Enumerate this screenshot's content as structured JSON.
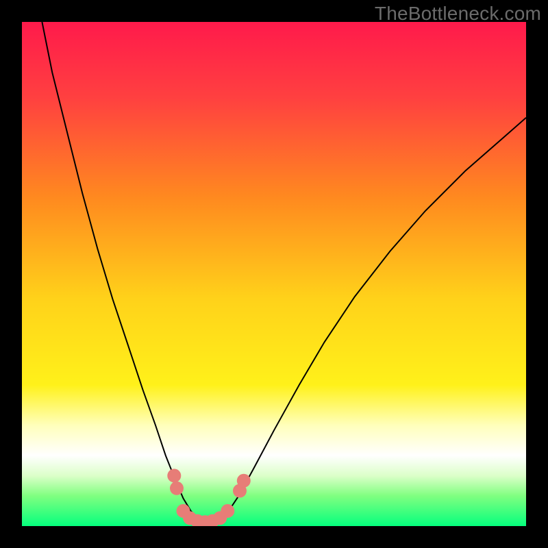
{
  "watermark": "TheBottleneck.com",
  "chart_data": {
    "type": "line",
    "title": "",
    "xlabel": "",
    "ylabel": "",
    "xlim": [
      0,
      100
    ],
    "ylim": [
      0,
      100
    ],
    "grid": false,
    "legend": false,
    "gradient_stops": [
      {
        "offset": 0.0,
        "color": "#ff1a4b"
      },
      {
        "offset": 0.15,
        "color": "#ff4040"
      },
      {
        "offset": 0.35,
        "color": "#ff8a1f"
      },
      {
        "offset": 0.55,
        "color": "#ffd21a"
      },
      {
        "offset": 0.72,
        "color": "#fff11a"
      },
      {
        "offset": 0.8,
        "color": "#ffffbb"
      },
      {
        "offset": 0.86,
        "color": "#ffffff"
      },
      {
        "offset": 0.9,
        "color": "#dcffc9"
      },
      {
        "offset": 0.94,
        "color": "#80ff80"
      },
      {
        "offset": 1.0,
        "color": "#05ff7d"
      }
    ],
    "series": [
      {
        "name": "bottleneck-curve",
        "stroke": "#000000",
        "stroke_width": 2,
        "points": [
          {
            "x": 4.0,
            "y": 100.0
          },
          {
            "x": 6.0,
            "y": 90.0
          },
          {
            "x": 9.0,
            "y": 78.0
          },
          {
            "x": 12.0,
            "y": 66.0
          },
          {
            "x": 15.0,
            "y": 55.0
          },
          {
            "x": 18.0,
            "y": 45.0
          },
          {
            "x": 21.0,
            "y": 36.0
          },
          {
            "x": 24.0,
            "y": 27.0
          },
          {
            "x": 26.5,
            "y": 20.0
          },
          {
            "x": 28.5,
            "y": 14.0
          },
          {
            "x": 30.5,
            "y": 9.0
          },
          {
            "x": 32.0,
            "y": 5.5
          },
          {
            "x": 33.5,
            "y": 3.0
          },
          {
            "x": 35.0,
            "y": 1.5
          },
          {
            "x": 36.5,
            "y": 0.8
          },
          {
            "x": 38.0,
            "y": 0.8
          },
          {
            "x": 39.5,
            "y": 1.5
          },
          {
            "x": 41.0,
            "y": 3.0
          },
          {
            "x": 43.0,
            "y": 6.0
          },
          {
            "x": 46.0,
            "y": 11.5
          },
          {
            "x": 50.0,
            "y": 19.0
          },
          {
            "x": 55.0,
            "y": 28.0
          },
          {
            "x": 60.0,
            "y": 36.5
          },
          {
            "x": 66.0,
            "y": 45.5
          },
          {
            "x": 73.0,
            "y": 54.5
          },
          {
            "x": 80.0,
            "y": 62.5
          },
          {
            "x": 88.0,
            "y": 70.5
          },
          {
            "x": 96.0,
            "y": 77.5
          },
          {
            "x": 100.0,
            "y": 81.0
          }
        ]
      }
    ],
    "markers": {
      "fill": "#e77d77",
      "radius": 10,
      "points": [
        {
          "x": 30.2,
          "y": 10.0
        },
        {
          "x": 30.7,
          "y": 7.5
        },
        {
          "x": 32.0,
          "y": 3.0
        },
        {
          "x": 33.3,
          "y": 1.6
        },
        {
          "x": 34.8,
          "y": 1.0
        },
        {
          "x": 36.3,
          "y": 0.8
        },
        {
          "x": 37.8,
          "y": 1.0
        },
        {
          "x": 39.3,
          "y": 1.6
        },
        {
          "x": 40.8,
          "y": 3.0
        },
        {
          "x": 43.2,
          "y": 7.0
        },
        {
          "x": 44.0,
          "y": 9.0
        }
      ]
    }
  }
}
